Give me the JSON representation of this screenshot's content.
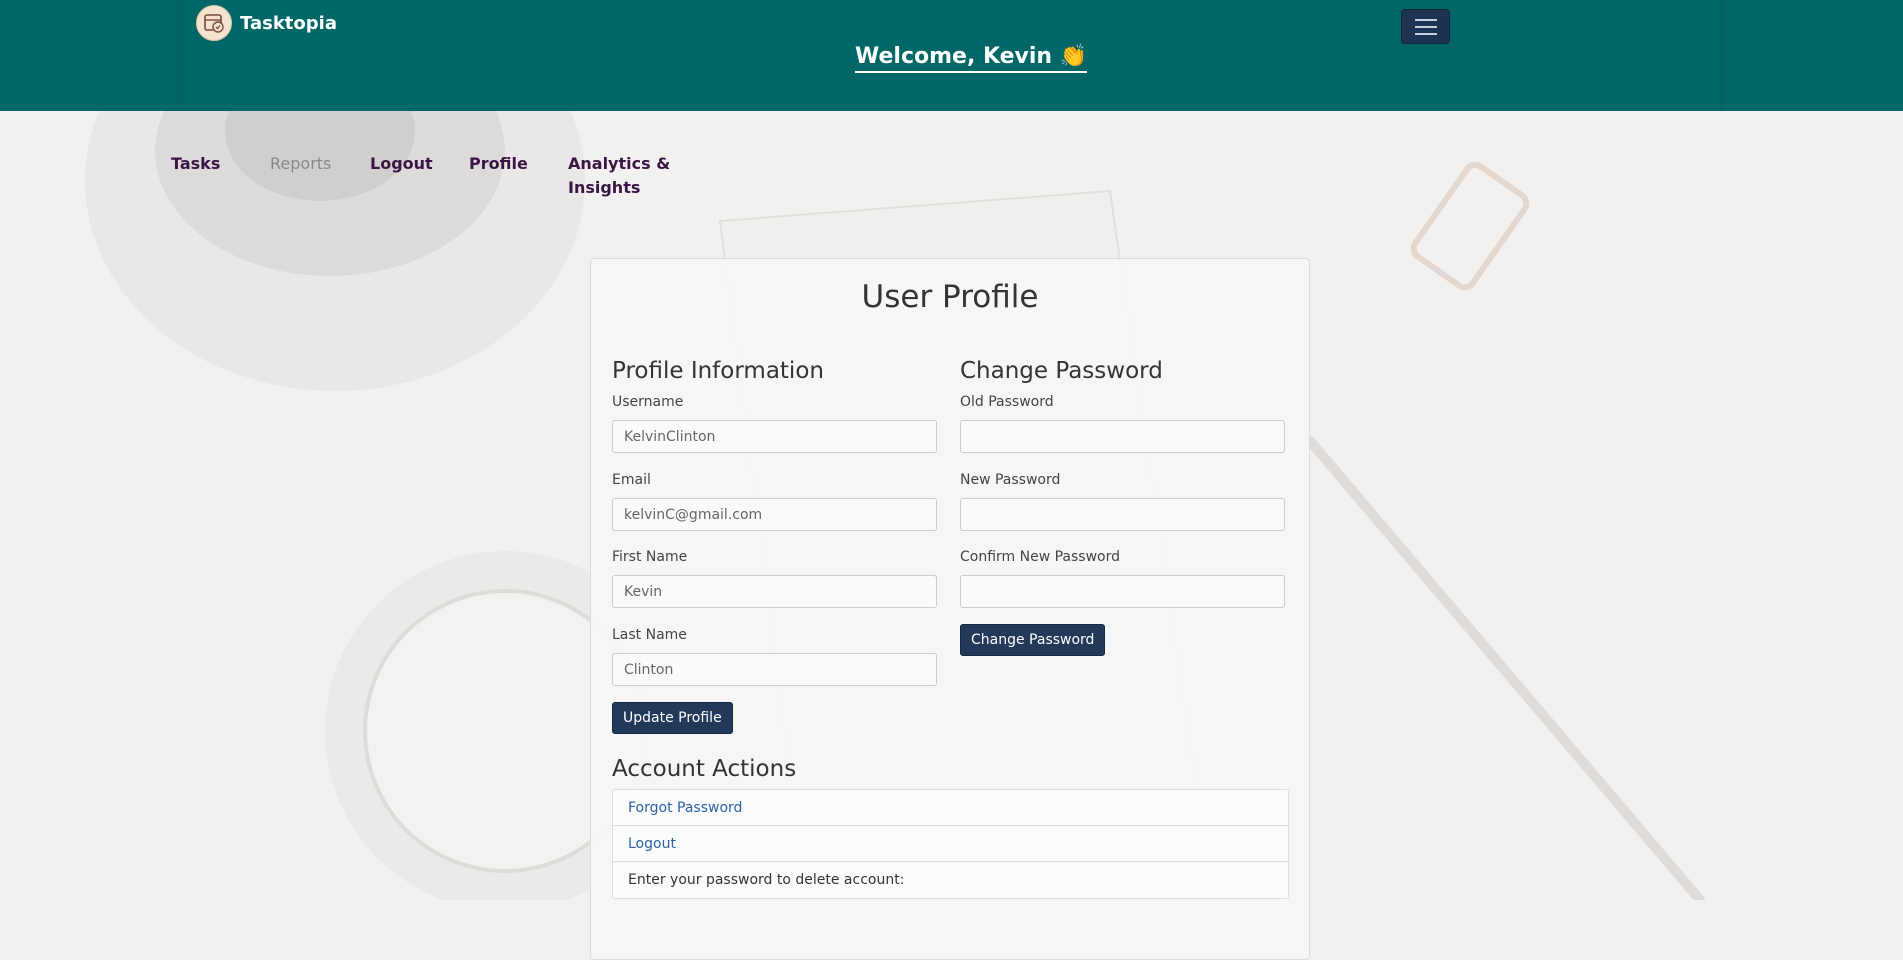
{
  "header": {
    "brand": "Tasktopia",
    "welcome": "Welcome, Kevin 👏"
  },
  "nav": {
    "items": [
      {
        "label": "Tasks"
      },
      {
        "label": "Reports"
      },
      {
        "label": "Logout"
      },
      {
        "label": "Profile"
      },
      {
        "label": "Analytics &"
      },
      {
        "label": "Insights"
      }
    ]
  },
  "profile": {
    "title": "User Profile",
    "info": {
      "heading": "Profile Information",
      "username_label": "Username",
      "username_value": "KelvinClinton",
      "email_label": "Email",
      "email_value": "kelvinC@gmail.com",
      "first_name_label": "First Name",
      "first_name_value": "Kevin",
      "last_name_label": "Last Name",
      "last_name_value": "Clinton",
      "update_button": "Update Profile"
    },
    "password": {
      "heading": "Change Password",
      "old_label": "Old Password",
      "new_label": "New Password",
      "confirm_label": "Confirm New Password",
      "change_button": "Change Password"
    },
    "account": {
      "heading": "Account Actions",
      "forgot": "Forgot Password",
      "logout": "Logout",
      "delete_prompt": "Enter your password to delete account:"
    }
  },
  "colors": {
    "header_bg": "#006666",
    "button_bg": "#22395a",
    "nav_text": "#3a1645",
    "link": "#2a62a6"
  }
}
